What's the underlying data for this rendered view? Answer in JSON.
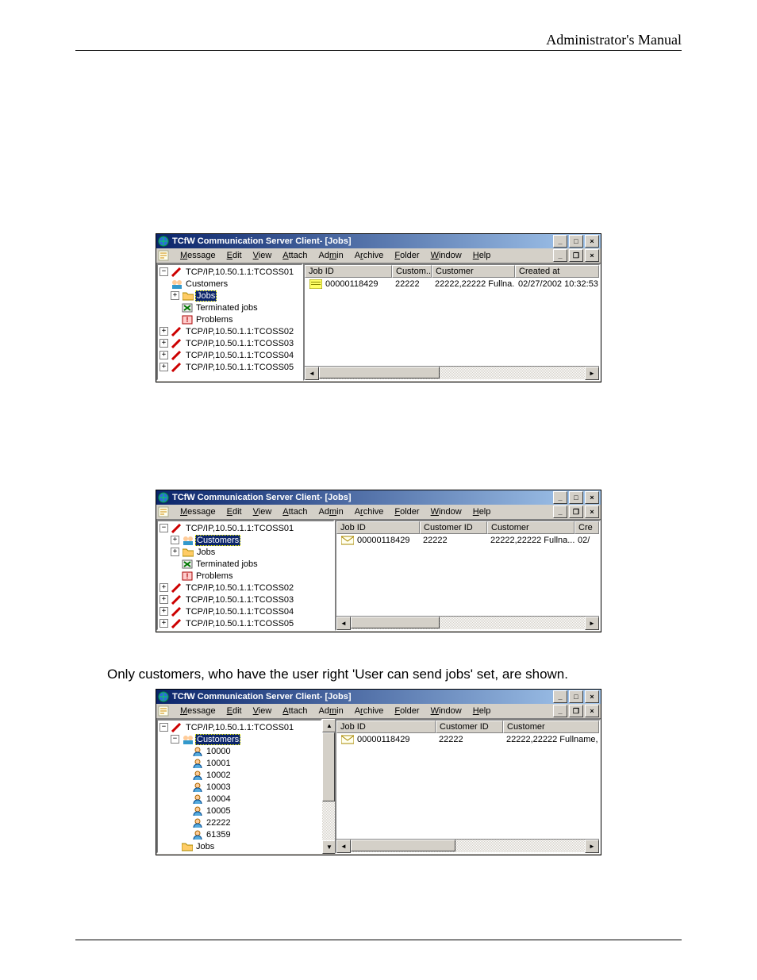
{
  "page_header": "Administrator's Manual",
  "window_title": "TCfW Communication Server Client- [Jobs]",
  "menus": [
    "Message",
    "Edit",
    "View",
    "Attach",
    "Admin",
    "Archive",
    "Folder",
    "Window",
    "Help"
  ],
  "menu_accel_idx": [
    0,
    0,
    0,
    0,
    2,
    1,
    0,
    0,
    0
  ],
  "servers": {
    "s1": "TCP/IP,10.50.1.1:TCOSS01",
    "s2": "TCP/IP,10.50.1.1:TCOSS02",
    "s3": "TCP/IP,10.50.1.1:TCOSS03",
    "s4": "TCP/IP,10.50.1.1:TCOSS04",
    "s5": "TCP/IP,10.50.1.1:TCOSS05"
  },
  "tree_nodes": {
    "customers": "Customers",
    "jobs": "Jobs",
    "terminated": "Terminated jobs",
    "problems": "Problems"
  },
  "win1": {
    "columns": {
      "c1": "Job ID",
      "c2": "Custom...",
      "c3": "Customer",
      "c4": "Created at"
    },
    "row": {
      "jobid": "00000118429",
      "custom": "22222",
      "customer": "22222,22222 Fullna...",
      "created": "02/27/2002 10:32:53"
    }
  },
  "win2": {
    "columns": {
      "c1": "Job ID",
      "c2": "Customer ID",
      "c3": "Customer",
      "c4": "Cre"
    },
    "row": {
      "jobid": "00000118429",
      "custid": "22222",
      "customer": "22222,22222 Fullna...",
      "cre": "02/"
    }
  },
  "caption": "Only customers, who have the user right 'User can send jobs' set, are shown.",
  "win3": {
    "columns": {
      "c1": "Job ID",
      "c2": "Customer ID",
      "c3": "Customer"
    },
    "row": {
      "jobid": "00000118429",
      "custid": "22222",
      "customer": "22222,22222 Fullname,"
    },
    "customer_ids": [
      "10000",
      "10001",
      "10002",
      "10003",
      "10004",
      "10005",
      "22222",
      "61359"
    ]
  }
}
